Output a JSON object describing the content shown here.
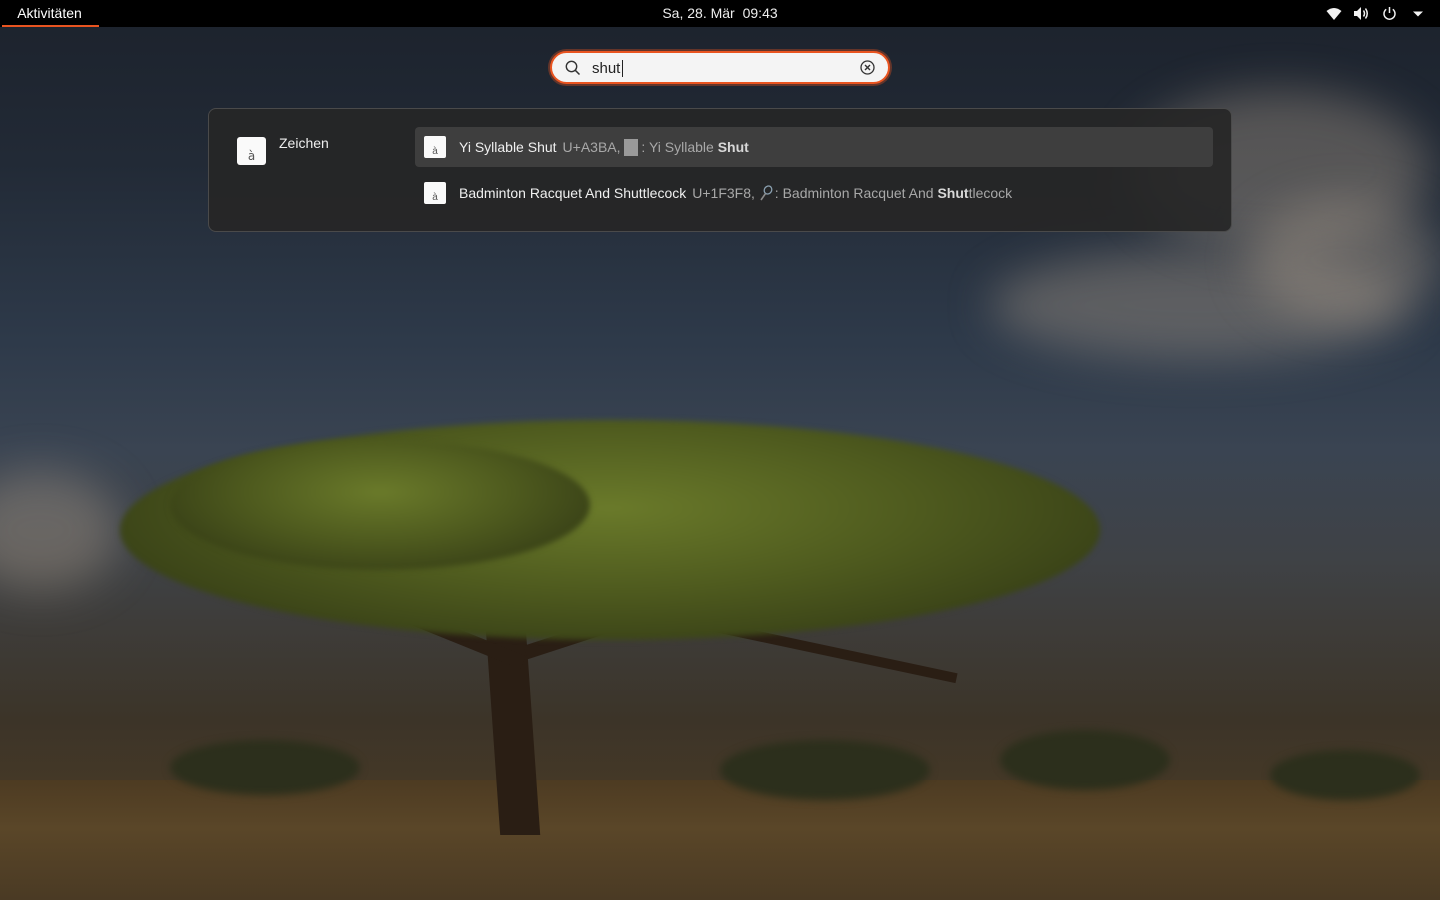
{
  "topbar": {
    "activities_label": "Aktivitäten",
    "date": "Sa, 28. Mär",
    "time": "09:43",
    "tray_icons": [
      "wifi-icon",
      "volume-icon",
      "power-icon",
      "chevron-down-icon"
    ]
  },
  "search": {
    "value": "shut",
    "placeholder": ""
  },
  "results": {
    "provider": {
      "name": "Zeichen",
      "icon_glyph": "à"
    },
    "items": [
      {
        "icon_glyph": "à",
        "title": "Yi Syllable Shut",
        "code": "U+A3BA,",
        "desc_prefix": ": Yi Syllable ",
        "desc_match": "Shut",
        "desc_suffix": "",
        "selected": true
      },
      {
        "icon_glyph": "à",
        "title": "Badminton Racquet And Shuttlecock",
        "code": "U+1F3F8,",
        "desc_prefix": ": Badminton Racquet And ",
        "desc_match": "Shut",
        "desc_suffix": "tlecock",
        "selected": false
      }
    ]
  },
  "colors": {
    "accent": "#e95420",
    "panel_bg": "#262626",
    "selected_row": "#3e3e3e"
  }
}
